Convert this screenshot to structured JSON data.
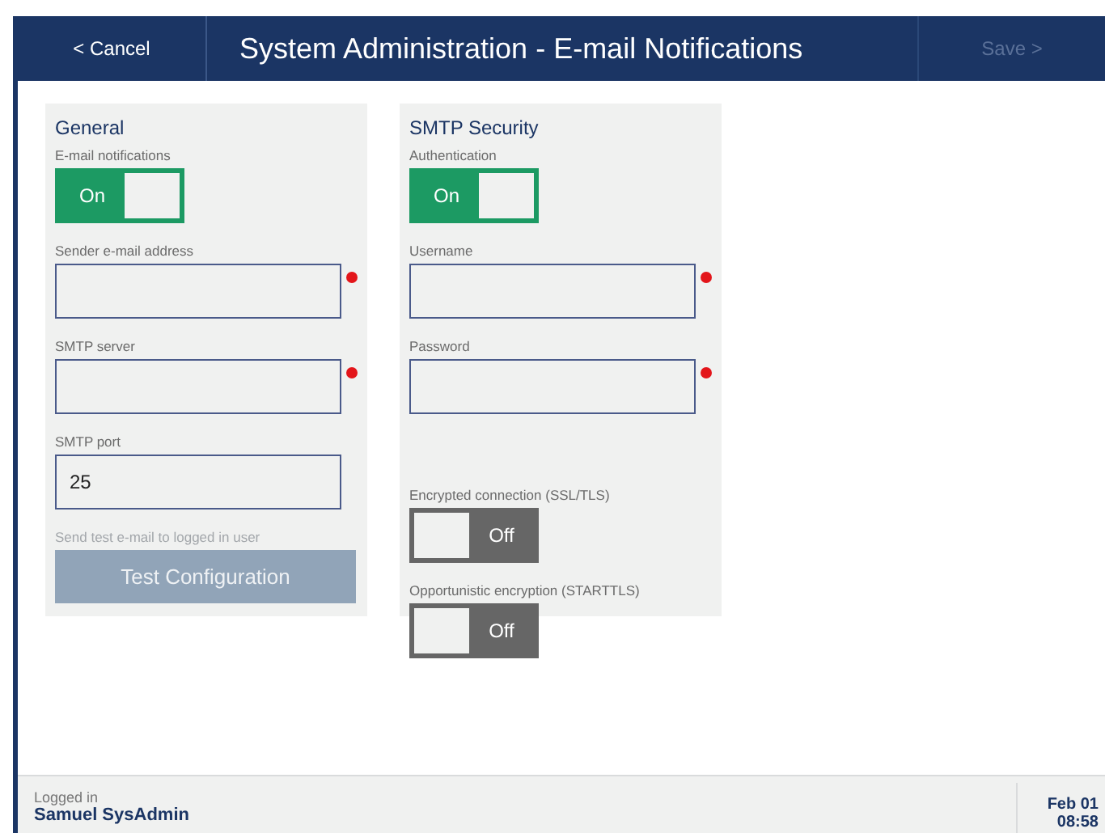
{
  "header": {
    "cancel": "< Cancel",
    "title": "System Administration - E-mail Notifications",
    "save": {
      "label": "Save >",
      "disabled": true
    }
  },
  "sections": [
    {
      "title": "General",
      "items": [
        {
          "kind": "toggle",
          "label": "E-mail notifications",
          "on": true,
          "text": "On"
        },
        {
          "kind": "input",
          "label": "Sender e-mail address",
          "value": "",
          "required": true
        },
        {
          "kind": "input",
          "label": "SMTP server",
          "value": "",
          "required": true
        },
        {
          "kind": "input",
          "label": "SMTP port",
          "value": "25"
        },
        {
          "kind": "button",
          "label": "Send test e-mail to logged in user",
          "button": "Test Configuration",
          "disabled": true
        }
      ]
    },
    {
      "title": "SMTP Security",
      "items": [
        {
          "kind": "toggle",
          "label": "Authentication",
          "on": true,
          "text": "On"
        },
        {
          "kind": "input",
          "label": "Username",
          "value": "",
          "required": true
        },
        {
          "kind": "input",
          "label": "Password",
          "value": "",
          "required": true
        },
        {
          "kind": "toggle",
          "label": "Encrypted connection (SSL/TLS)",
          "on": false,
          "text": "Off"
        },
        {
          "kind": "toggle",
          "label": "Opportunistic encryption (STARTTLS)",
          "on": false,
          "text": "Off"
        }
      ]
    }
  ],
  "footer": {
    "label": "Logged in",
    "user": "Samuel SysAdmin",
    "date": "Feb 01",
    "time": "08:58"
  }
}
